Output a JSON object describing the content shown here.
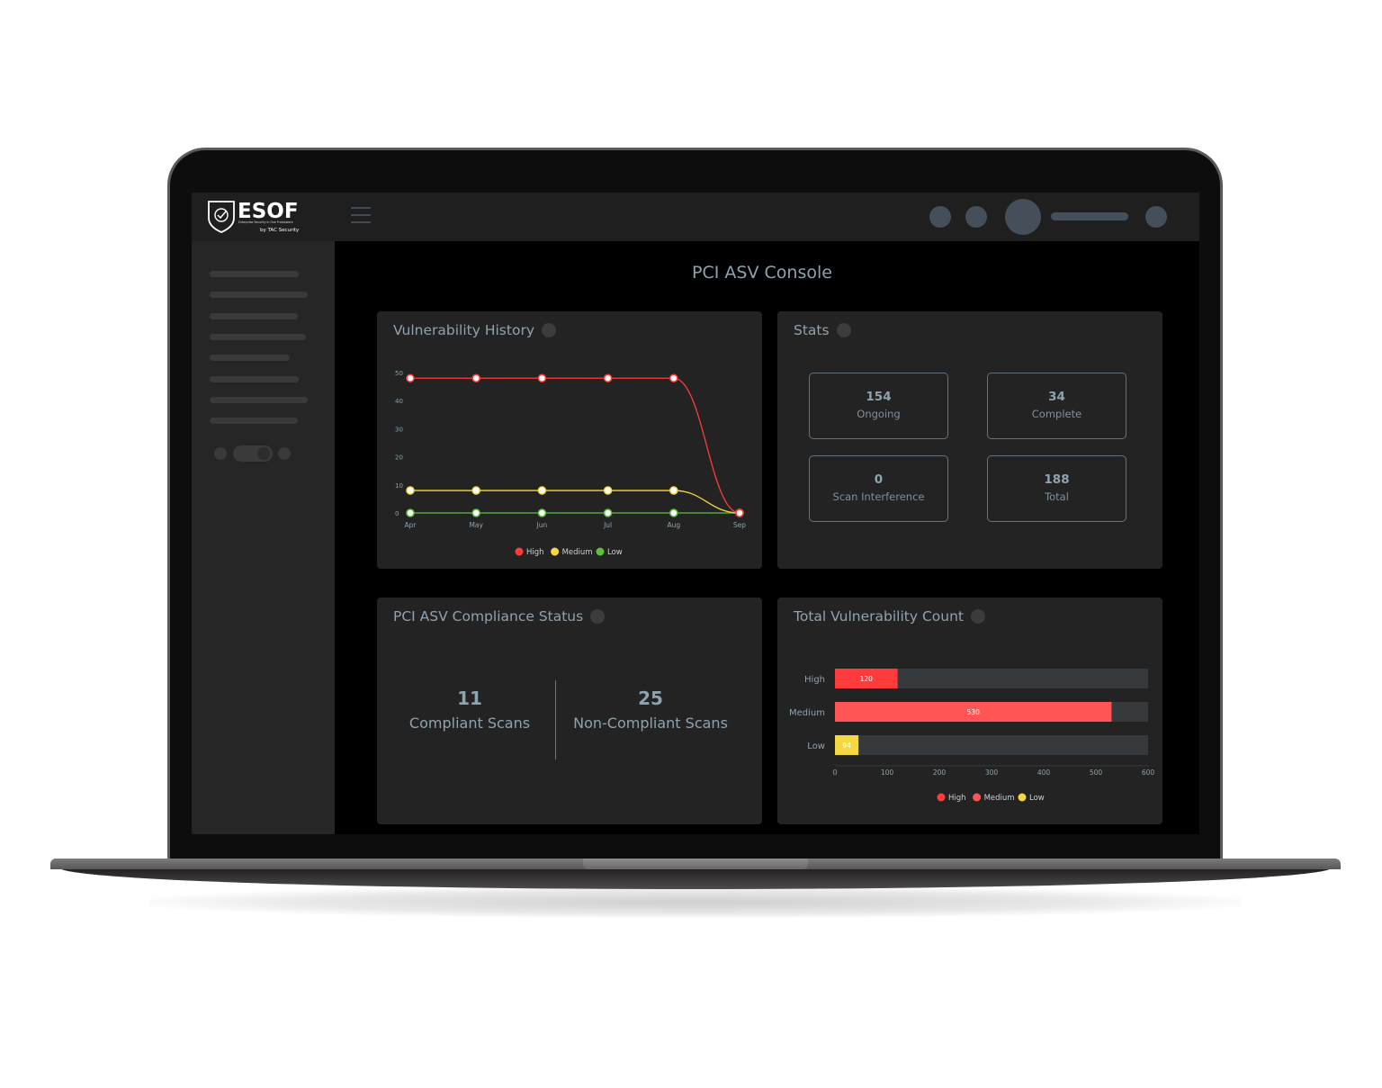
{
  "app": {
    "logo_text": "ESOF",
    "logo_tagline": "Enterprise Security in One Framework",
    "logo_byline": "by TAC Security"
  },
  "page_title": "PCI ASV Console",
  "colors": {
    "high": "#ff3b3b",
    "medium": "#f5d840",
    "low": "#5fbf3a",
    "bar_medium": "#ff5555",
    "text_muted": "#8fa3af"
  },
  "cards": {
    "vuln_history": {
      "title": "Vulnerability History"
    },
    "stats": {
      "title": "Stats",
      "items": [
        {
          "value": "154",
          "label": "Ongoing"
        },
        {
          "value": "34",
          "label": "Complete"
        },
        {
          "value": "0",
          "label": "Scan Interference"
        },
        {
          "value": "188",
          "label": "Total"
        }
      ]
    },
    "compliance": {
      "title": "PCI ASV Compliance Status",
      "compliant_value": "11",
      "compliant_label": "Compliant Scans",
      "noncompliant_value": "25",
      "noncompliant_label": "Non-Compliant Scans"
    },
    "total_vuln": {
      "title": "Total Vulnerability Count"
    }
  },
  "chart_data": [
    {
      "type": "line",
      "title": "Vulnerability History",
      "x": [
        "Apr",
        "May",
        "Jun",
        "Jul",
        "Aug",
        "Sep"
      ],
      "ylim": [
        0,
        50
      ],
      "yticks": [
        0,
        10,
        20,
        30,
        40,
        50
      ],
      "series": [
        {
          "name": "High",
          "color": "#ff3b3b",
          "values": [
            48,
            48,
            48,
            48,
            48,
            0
          ]
        },
        {
          "name": "Medium",
          "color": "#f5d840",
          "values": [
            8,
            8,
            8,
            8,
            8,
            0
          ]
        },
        {
          "name": "Low",
          "color": "#5fbf3a",
          "values": [
            0,
            0,
            0,
            0,
            0,
            0
          ]
        }
      ],
      "legend": [
        "High",
        "Medium",
        "Low"
      ],
      "legend_position": "bottom"
    },
    {
      "type": "bar",
      "orientation": "horizontal",
      "title": "Total Vulnerability Count",
      "categories": [
        "High",
        "Medium",
        "Low"
      ],
      "values": [
        120,
        530,
        94
      ],
      "value_labels": [
        "120",
        "530",
        "94"
      ],
      "colors": [
        "#ff3b3b",
        "#ff5555",
        "#f5d840"
      ],
      "xlim": [
        0,
        600
      ],
      "xticks": [
        0,
        100,
        200,
        300,
        400,
        500,
        600
      ],
      "legend": [
        {
          "name": "High",
          "color": "#ff3b3b"
        },
        {
          "name": "Medium",
          "color": "#ff5555"
        },
        {
          "name": "Low",
          "color": "#f5d840"
        }
      ],
      "legend_position": "bottom"
    }
  ]
}
